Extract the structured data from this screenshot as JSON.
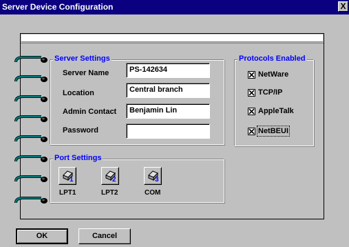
{
  "window": {
    "title": "Server Device Configuration",
    "close_label": "X"
  },
  "server_settings": {
    "title": "Server Settings",
    "fields": [
      {
        "label": "Server Name",
        "value": "PS-142634"
      },
      {
        "label": "Location",
        "value": "Central branch"
      },
      {
        "label": "Admin Contact",
        "value": "Benjamin Lin"
      },
      {
        "label": "Password",
        "value": ""
      }
    ]
  },
  "protocols": {
    "title": "Protocols Enabled",
    "items": [
      {
        "label": "NetWare",
        "checked": true
      },
      {
        "label": "TCP/IP",
        "checked": true
      },
      {
        "label": "AppleTalk",
        "checked": true
      },
      {
        "label": "NetBEUI",
        "checked": true
      }
    ]
  },
  "port_settings": {
    "title": "Port Settings",
    "ports": [
      {
        "number": "1",
        "label": "LPT1"
      },
      {
        "number": "2",
        "label": "LPT2"
      },
      {
        "number": "3",
        "label": "COM"
      }
    ]
  },
  "buttons": {
    "ok": "OK",
    "cancel": "Cancel"
  },
  "colors": {
    "titlebar": "#0a0080",
    "face": "#c0c0c0",
    "group_title": "#0000ff",
    "ring": "#007878"
  },
  "icons": {
    "ring": "notebook-ring-icon",
    "printer": "printer-icon",
    "check": "checkmark-icon"
  }
}
